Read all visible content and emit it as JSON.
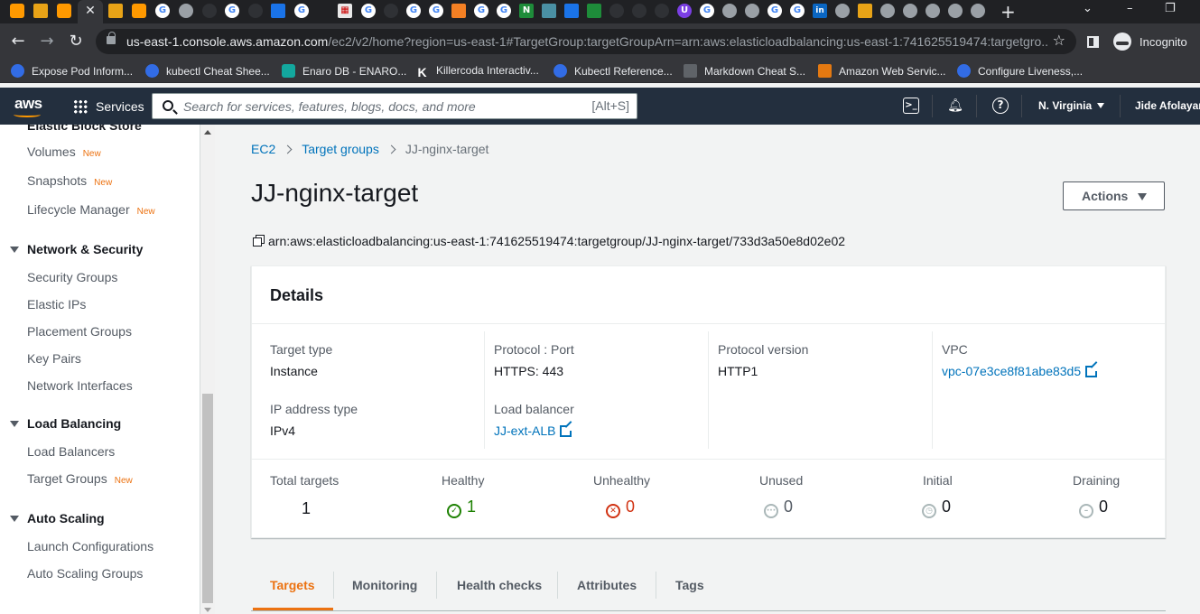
{
  "browser": {
    "tab_icons": [
      "aws-icon",
      "box-icon",
      "aws-icon",
      "close-icon",
      "box-icon",
      "aws-icon",
      "google-icon",
      "github-icon",
      "github-icon",
      "google-icon",
      "github-icon",
      "azure-icon",
      "google-icon",
      "calendar-icon",
      "google-icon",
      "github-icon",
      "google-icon",
      "google-icon",
      "stackoverflow-icon",
      "google-icon",
      "google-icon",
      "nginx-icon",
      "ansible-icon",
      "kubeclarity-icon",
      "terminal-icon",
      "terraform-icon",
      "github-icon",
      "helm-icon",
      "udemy-icon",
      "google-icon",
      "person-icon",
      "google-icon",
      "google-icon",
      "google-icon",
      "linkedin-icon",
      "incognito-icon",
      "box-icon",
      "google-icon",
      "google-icon",
      "google-icon",
      "google-icon"
    ],
    "url_host": "us-east-1.console.aws.amazon.com",
    "url_path": "/ec2/v2/home?region=us-east-1#TargetGroup:targetGroupArn=arn:aws:elasticloadbalancing:us-east-1:741625519474:targetgro...",
    "incognito_label": "Incognito",
    "bookmarks": [
      {
        "label": "Expose Pod Inform...",
        "icon": "kubernetes-icon"
      },
      {
        "label": "kubectl Cheat Shee...",
        "icon": "kubernetes-icon"
      },
      {
        "label": "Enaro DB - ENARO...",
        "icon": "s-icon"
      },
      {
        "label": "Killercoda Interactiv...",
        "icon": "killercoda-icon"
      },
      {
        "label": "Kubectl Reference...",
        "icon": "kubernetes-icon"
      },
      {
        "label": "Markdown Cheat S...",
        "icon": "markdown-icon"
      },
      {
        "label": "Amazon Web Servic...",
        "icon": "aws-icon"
      },
      {
        "label": "Configure Liveness,...",
        "icon": "kubernetes-icon"
      }
    ]
  },
  "aws_nav": {
    "logo": "aws",
    "services_label": "Services",
    "search_placeholder": "Search for services, features, blogs, docs, and more",
    "search_shortcut": "[Alt+S]",
    "region": "N. Virginia",
    "user": "Jide Afolayan"
  },
  "sidebar": {
    "cut_section": "Elastic Block Store",
    "new_badge": "New",
    "ebs_items": [
      {
        "label": "Volumes",
        "new": true
      },
      {
        "label": "Snapshots",
        "new": true
      },
      {
        "label": "Lifecycle Manager",
        "new": true
      }
    ],
    "network_security": {
      "title": "Network & Security",
      "items": [
        "Security Groups",
        "Elastic IPs",
        "Placement Groups",
        "Key Pairs",
        "Network Interfaces"
      ]
    },
    "load_balancing": {
      "title": "Load Balancing",
      "items": [
        {
          "label": "Load Balancers",
          "new": false
        },
        {
          "label": "Target Groups",
          "new": true
        }
      ]
    },
    "auto_scaling": {
      "title": "Auto Scaling",
      "items": [
        "Launch Configurations",
        "Auto Scaling Groups"
      ]
    }
  },
  "breadcrumb": [
    "EC2",
    "Target groups",
    "JJ-nginx-target"
  ],
  "page_title": "JJ-nginx-target",
  "actions_label": "Actions",
  "arn": "arn:aws:elasticloadbalancing:us-east-1:741625519474:targetgroup/JJ-nginx-target/733d3a50e8d02e02",
  "details": {
    "title": "Details",
    "target_type": {
      "label": "Target type",
      "value": "Instance"
    },
    "protocol_port": {
      "label": "Protocol : Port",
      "value": "HTTPS: 443"
    },
    "protocol_version": {
      "label": "Protocol version",
      "value": "HTTP1"
    },
    "vpc": {
      "label": "VPC",
      "value": "vpc-07e3ce8f81abe83d5"
    },
    "ip_address_type": {
      "label": "IP address type",
      "value": "IPv4"
    },
    "load_balancer": {
      "label": "Load balancer",
      "value": "JJ-ext-ALB"
    }
  },
  "summary": {
    "total": {
      "label": "Total targets",
      "value": "1"
    },
    "healthy": {
      "label": "Healthy",
      "value": "1"
    },
    "unhealthy": {
      "label": "Unhealthy",
      "value": "0"
    },
    "unused": {
      "label": "Unused",
      "value": "0"
    },
    "initial": {
      "label": "Initial",
      "value": "0"
    },
    "draining": {
      "label": "Draining",
      "value": "0"
    }
  },
  "tabs": [
    "Targets",
    "Monitoring",
    "Health checks",
    "Attributes",
    "Tags"
  ],
  "colors": {
    "accent_orange": "#ec7211",
    "link_blue": "#0073bb",
    "healthy_green": "#1d8102",
    "unhealthy_red": "#d13212",
    "nav_bg": "#232f3e"
  }
}
